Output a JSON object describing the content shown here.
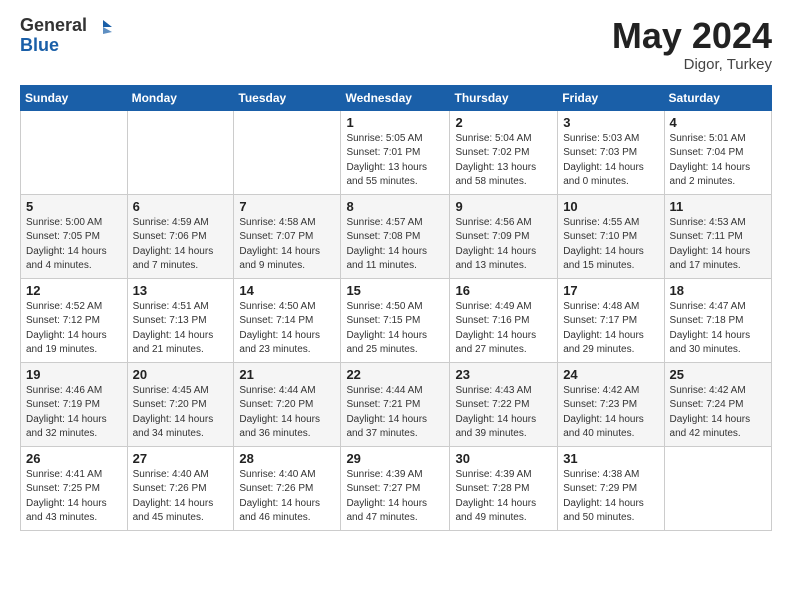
{
  "header": {
    "logo_general": "General",
    "logo_blue": "Blue",
    "title_month": "May 2024",
    "title_location": "Digor, Turkey"
  },
  "days_of_week": [
    "Sunday",
    "Monday",
    "Tuesday",
    "Wednesday",
    "Thursday",
    "Friday",
    "Saturday"
  ],
  "weeks": [
    [
      {
        "day": "",
        "info": ""
      },
      {
        "day": "",
        "info": ""
      },
      {
        "day": "",
        "info": ""
      },
      {
        "day": "1",
        "info": "Sunrise: 5:05 AM\nSunset: 7:01 PM\nDaylight: 13 hours\nand 55 minutes."
      },
      {
        "day": "2",
        "info": "Sunrise: 5:04 AM\nSunset: 7:02 PM\nDaylight: 13 hours\nand 58 minutes."
      },
      {
        "day": "3",
        "info": "Sunrise: 5:03 AM\nSunset: 7:03 PM\nDaylight: 14 hours\nand 0 minutes."
      },
      {
        "day": "4",
        "info": "Sunrise: 5:01 AM\nSunset: 7:04 PM\nDaylight: 14 hours\nand 2 minutes."
      }
    ],
    [
      {
        "day": "5",
        "info": "Sunrise: 5:00 AM\nSunset: 7:05 PM\nDaylight: 14 hours\nand 4 minutes."
      },
      {
        "day": "6",
        "info": "Sunrise: 4:59 AM\nSunset: 7:06 PM\nDaylight: 14 hours\nand 7 minutes."
      },
      {
        "day": "7",
        "info": "Sunrise: 4:58 AM\nSunset: 7:07 PM\nDaylight: 14 hours\nand 9 minutes."
      },
      {
        "day": "8",
        "info": "Sunrise: 4:57 AM\nSunset: 7:08 PM\nDaylight: 14 hours\nand 11 minutes."
      },
      {
        "day": "9",
        "info": "Sunrise: 4:56 AM\nSunset: 7:09 PM\nDaylight: 14 hours\nand 13 minutes."
      },
      {
        "day": "10",
        "info": "Sunrise: 4:55 AM\nSunset: 7:10 PM\nDaylight: 14 hours\nand 15 minutes."
      },
      {
        "day": "11",
        "info": "Sunrise: 4:53 AM\nSunset: 7:11 PM\nDaylight: 14 hours\nand 17 minutes."
      }
    ],
    [
      {
        "day": "12",
        "info": "Sunrise: 4:52 AM\nSunset: 7:12 PM\nDaylight: 14 hours\nand 19 minutes."
      },
      {
        "day": "13",
        "info": "Sunrise: 4:51 AM\nSunset: 7:13 PM\nDaylight: 14 hours\nand 21 minutes."
      },
      {
        "day": "14",
        "info": "Sunrise: 4:50 AM\nSunset: 7:14 PM\nDaylight: 14 hours\nand 23 minutes."
      },
      {
        "day": "15",
        "info": "Sunrise: 4:50 AM\nSunset: 7:15 PM\nDaylight: 14 hours\nand 25 minutes."
      },
      {
        "day": "16",
        "info": "Sunrise: 4:49 AM\nSunset: 7:16 PM\nDaylight: 14 hours\nand 27 minutes."
      },
      {
        "day": "17",
        "info": "Sunrise: 4:48 AM\nSunset: 7:17 PM\nDaylight: 14 hours\nand 29 minutes."
      },
      {
        "day": "18",
        "info": "Sunrise: 4:47 AM\nSunset: 7:18 PM\nDaylight: 14 hours\nand 30 minutes."
      }
    ],
    [
      {
        "day": "19",
        "info": "Sunrise: 4:46 AM\nSunset: 7:19 PM\nDaylight: 14 hours\nand 32 minutes."
      },
      {
        "day": "20",
        "info": "Sunrise: 4:45 AM\nSunset: 7:20 PM\nDaylight: 14 hours\nand 34 minutes."
      },
      {
        "day": "21",
        "info": "Sunrise: 4:44 AM\nSunset: 7:20 PM\nDaylight: 14 hours\nand 36 minutes."
      },
      {
        "day": "22",
        "info": "Sunrise: 4:44 AM\nSunset: 7:21 PM\nDaylight: 14 hours\nand 37 minutes."
      },
      {
        "day": "23",
        "info": "Sunrise: 4:43 AM\nSunset: 7:22 PM\nDaylight: 14 hours\nand 39 minutes."
      },
      {
        "day": "24",
        "info": "Sunrise: 4:42 AM\nSunset: 7:23 PM\nDaylight: 14 hours\nand 40 minutes."
      },
      {
        "day": "25",
        "info": "Sunrise: 4:42 AM\nSunset: 7:24 PM\nDaylight: 14 hours\nand 42 minutes."
      }
    ],
    [
      {
        "day": "26",
        "info": "Sunrise: 4:41 AM\nSunset: 7:25 PM\nDaylight: 14 hours\nand 43 minutes."
      },
      {
        "day": "27",
        "info": "Sunrise: 4:40 AM\nSunset: 7:26 PM\nDaylight: 14 hours\nand 45 minutes."
      },
      {
        "day": "28",
        "info": "Sunrise: 4:40 AM\nSunset: 7:26 PM\nDaylight: 14 hours\nand 46 minutes."
      },
      {
        "day": "29",
        "info": "Sunrise: 4:39 AM\nSunset: 7:27 PM\nDaylight: 14 hours\nand 47 minutes."
      },
      {
        "day": "30",
        "info": "Sunrise: 4:39 AM\nSunset: 7:28 PM\nDaylight: 14 hours\nand 49 minutes."
      },
      {
        "day": "31",
        "info": "Sunrise: 4:38 AM\nSunset: 7:29 PM\nDaylight: 14 hours\nand 50 minutes."
      },
      {
        "day": "",
        "info": ""
      }
    ]
  ]
}
